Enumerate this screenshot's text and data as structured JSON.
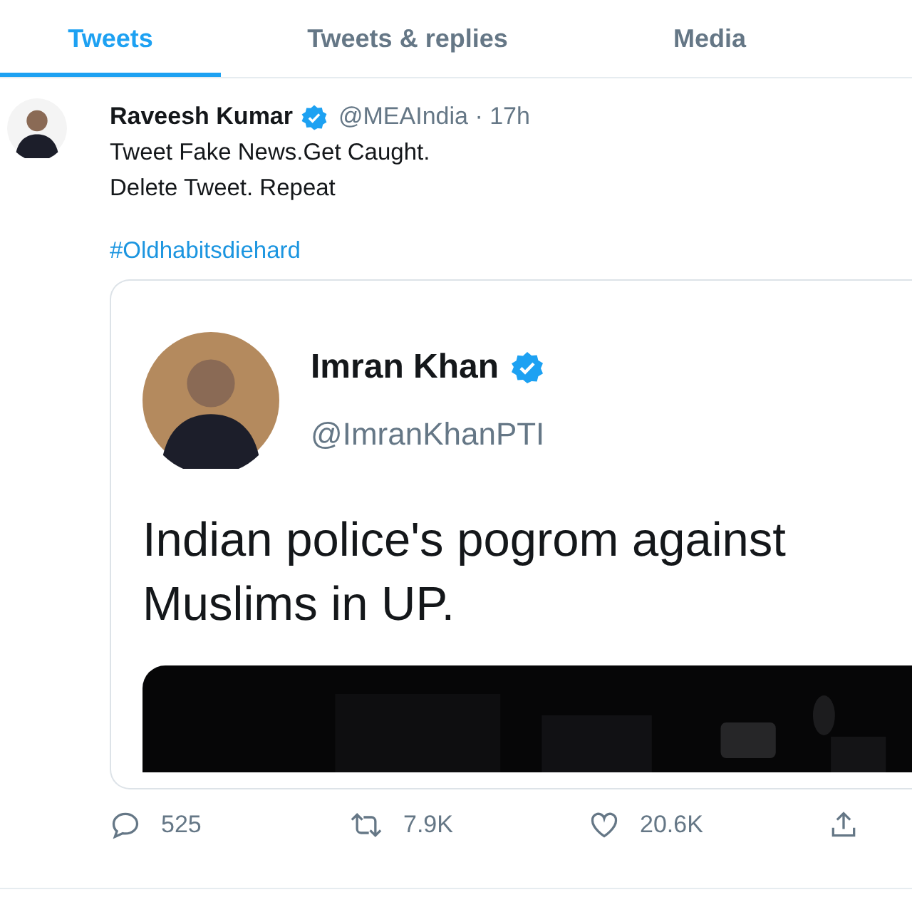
{
  "tabs": [
    {
      "label": "Tweets",
      "selected": true
    },
    {
      "label": "Tweets & replies",
      "selected": false
    },
    {
      "label": "Media",
      "selected": false
    }
  ],
  "tweet": {
    "author": {
      "name": "Raveesh Kumar",
      "verified": true,
      "meta": "@MEAIndia · 17h"
    },
    "text_lines": [
      "Tweet Fake News.Get Caught.",
      "Delete Tweet. Repeat"
    ],
    "hashtag": "#Oldhabitsdiehard",
    "embedded_screenshot": {
      "author": {
        "name": "Imran Khan",
        "verified": true,
        "handle": "@ImranKhanPTI"
      },
      "text": "Indian police's pogrom against Muslims in UP."
    },
    "actions": [
      {
        "kind": "reply",
        "count": "525"
      },
      {
        "kind": "retweet",
        "count": "7.9K"
      },
      {
        "kind": "like",
        "count": "20.6K"
      },
      {
        "kind": "share"
      }
    ]
  }
}
